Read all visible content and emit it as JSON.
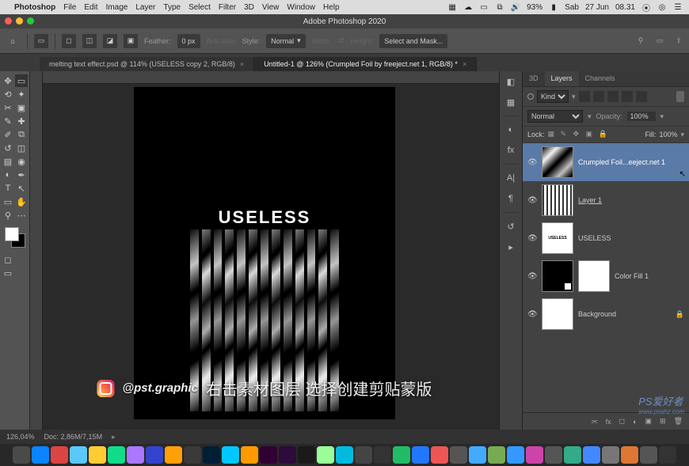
{
  "mac_menu": {
    "apple": "",
    "app": "Photoshop",
    "items": [
      "File",
      "Edit",
      "Image",
      "Layer",
      "Type",
      "Select",
      "Filter",
      "3D",
      "View",
      "Window",
      "Help"
    ],
    "status": {
      "battery": "93%",
      "day": "Sab",
      "date": "27 Jun",
      "time": "08.31"
    }
  },
  "window": {
    "title": "Adobe Photoshop 2020"
  },
  "options": {
    "feather_label": "Feather:",
    "feather_value": "0 px",
    "antialias": "Anti-alias",
    "style_label": "Style:",
    "style_value": "Normal",
    "width_label": "Width:",
    "height_label": "Height:",
    "select_mask": "Select and Mask..."
  },
  "tabs": [
    {
      "label": "melting text effect.psd @ 114% (USELESS copy 2, RGB/8)",
      "active": false
    },
    {
      "label": "Untitled-1 @ 126% (Crumpled Foil by freeject.net 1, RGB/8) *",
      "active": true
    }
  ],
  "canvas": {
    "text": "USELESS"
  },
  "overlay": {
    "handle": "@pst.graphic",
    "chinese": "右击素材图层 选择创建剪贴蒙版"
  },
  "panels": {
    "tabs": [
      "3D",
      "Layers",
      "Channels"
    ],
    "kind_label": "Kind",
    "blend": "Normal",
    "opacity_label": "Opacity:",
    "opacity": "100%",
    "lock_label": "Lock:",
    "fill_label": "Fill:",
    "fill": "100%",
    "layers": [
      {
        "name": "Crumpled Foil...eeject.net 1",
        "type": "foil",
        "eye": true,
        "active": true
      },
      {
        "name": "Layer 1",
        "type": "stripes",
        "eye": true,
        "underline": true
      },
      {
        "name": "USELESS",
        "type": "text",
        "eye": true
      },
      {
        "name": "Color Fill 1",
        "type": "cf",
        "eye": true,
        "mask": true
      },
      {
        "name": "Background",
        "type": "white",
        "eye": true,
        "locked": true
      }
    ]
  },
  "status": {
    "zoom": "126,04%",
    "doc": "Doc: 2,86M/7,15M"
  },
  "watermark": {
    "text": "PS爱好者",
    "url": "www.psahz.com"
  },
  "dock_colors": [
    "#4a4a4a",
    "#0a84ff",
    "#d44",
    "#5ac8fa",
    "#fc3",
    "#1d8",
    "#a7f",
    "#34c",
    "#ff9f0a",
    "#3a3a3a",
    "#001e36",
    "#00c8ff",
    "#ff9a00",
    "#310033",
    "#2d0b3a",
    "#1a1a1a",
    "#9f9",
    "#0bd",
    "#444",
    "#333",
    "#2b6",
    "#27f",
    "#e55",
    "#555",
    "#4af",
    "#7a5",
    "#39f",
    "#c4a",
    "#555",
    "#3a8",
    "#48f",
    "#777",
    "#d73",
    "#555",
    "#333"
  ]
}
